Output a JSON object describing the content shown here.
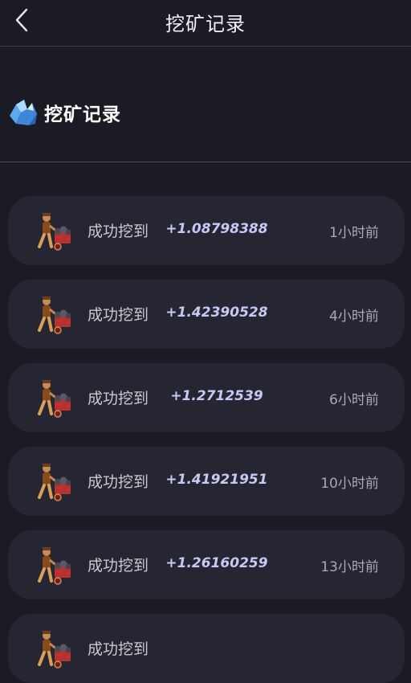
{
  "header": {
    "title": "挖矿记录",
    "back_icon": "chevron-left-icon"
  },
  "section": {
    "title": "挖矿记录",
    "icon": "crystal-icon"
  },
  "records": [
    {
      "label": "成功挖到",
      "amount": "+1.08798388",
      "time": "1小时前"
    },
    {
      "label": "成功挖到",
      "amount": "+1.42390528",
      "time": "4小时前"
    },
    {
      "label": "成功挖到",
      "amount": "+1.2712539",
      "time": "6小时前"
    },
    {
      "label": "成功挖到",
      "amount": "+1.41921951",
      "time": "10小时前"
    },
    {
      "label": "成功挖到",
      "amount": "+1.26160259",
      "time": "13小时前"
    },
    {
      "label": "成功挖到",
      "amount": "",
      "time": ""
    }
  ],
  "colors": {
    "background": "#1b1b25",
    "card": "#262632",
    "amount": "#c7c9f4",
    "crystal": "#7fc4ff"
  }
}
